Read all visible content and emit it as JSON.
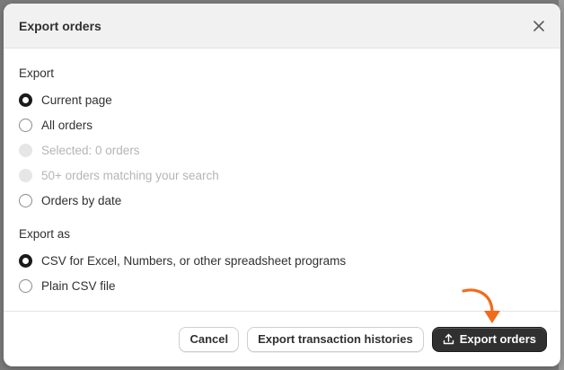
{
  "modal": {
    "title": "Export orders",
    "close_icon": "close-icon"
  },
  "export_section": {
    "label": "Export",
    "options": [
      {
        "label": "Current page",
        "state": "checked"
      },
      {
        "label": "All orders",
        "state": "unchecked"
      },
      {
        "label": "Selected: 0 orders",
        "state": "disabled"
      },
      {
        "label": "50+ orders matching your search",
        "state": "disabled"
      },
      {
        "label": "Orders by date",
        "state": "unchecked"
      }
    ]
  },
  "export_as_section": {
    "label": "Export as",
    "options": [
      {
        "label": "CSV for Excel, Numbers, or other spreadsheet programs",
        "state": "checked"
      },
      {
        "label": "Plain CSV file",
        "state": "unchecked"
      }
    ]
  },
  "footer": {
    "cancel_label": "Cancel",
    "export_histories_label": "Export transaction histories",
    "export_orders_label": "Export orders",
    "export_icon": "upload-icon"
  },
  "colors": {
    "primary_button": "#303030",
    "annotation_arrow": "#f26a1b"
  }
}
